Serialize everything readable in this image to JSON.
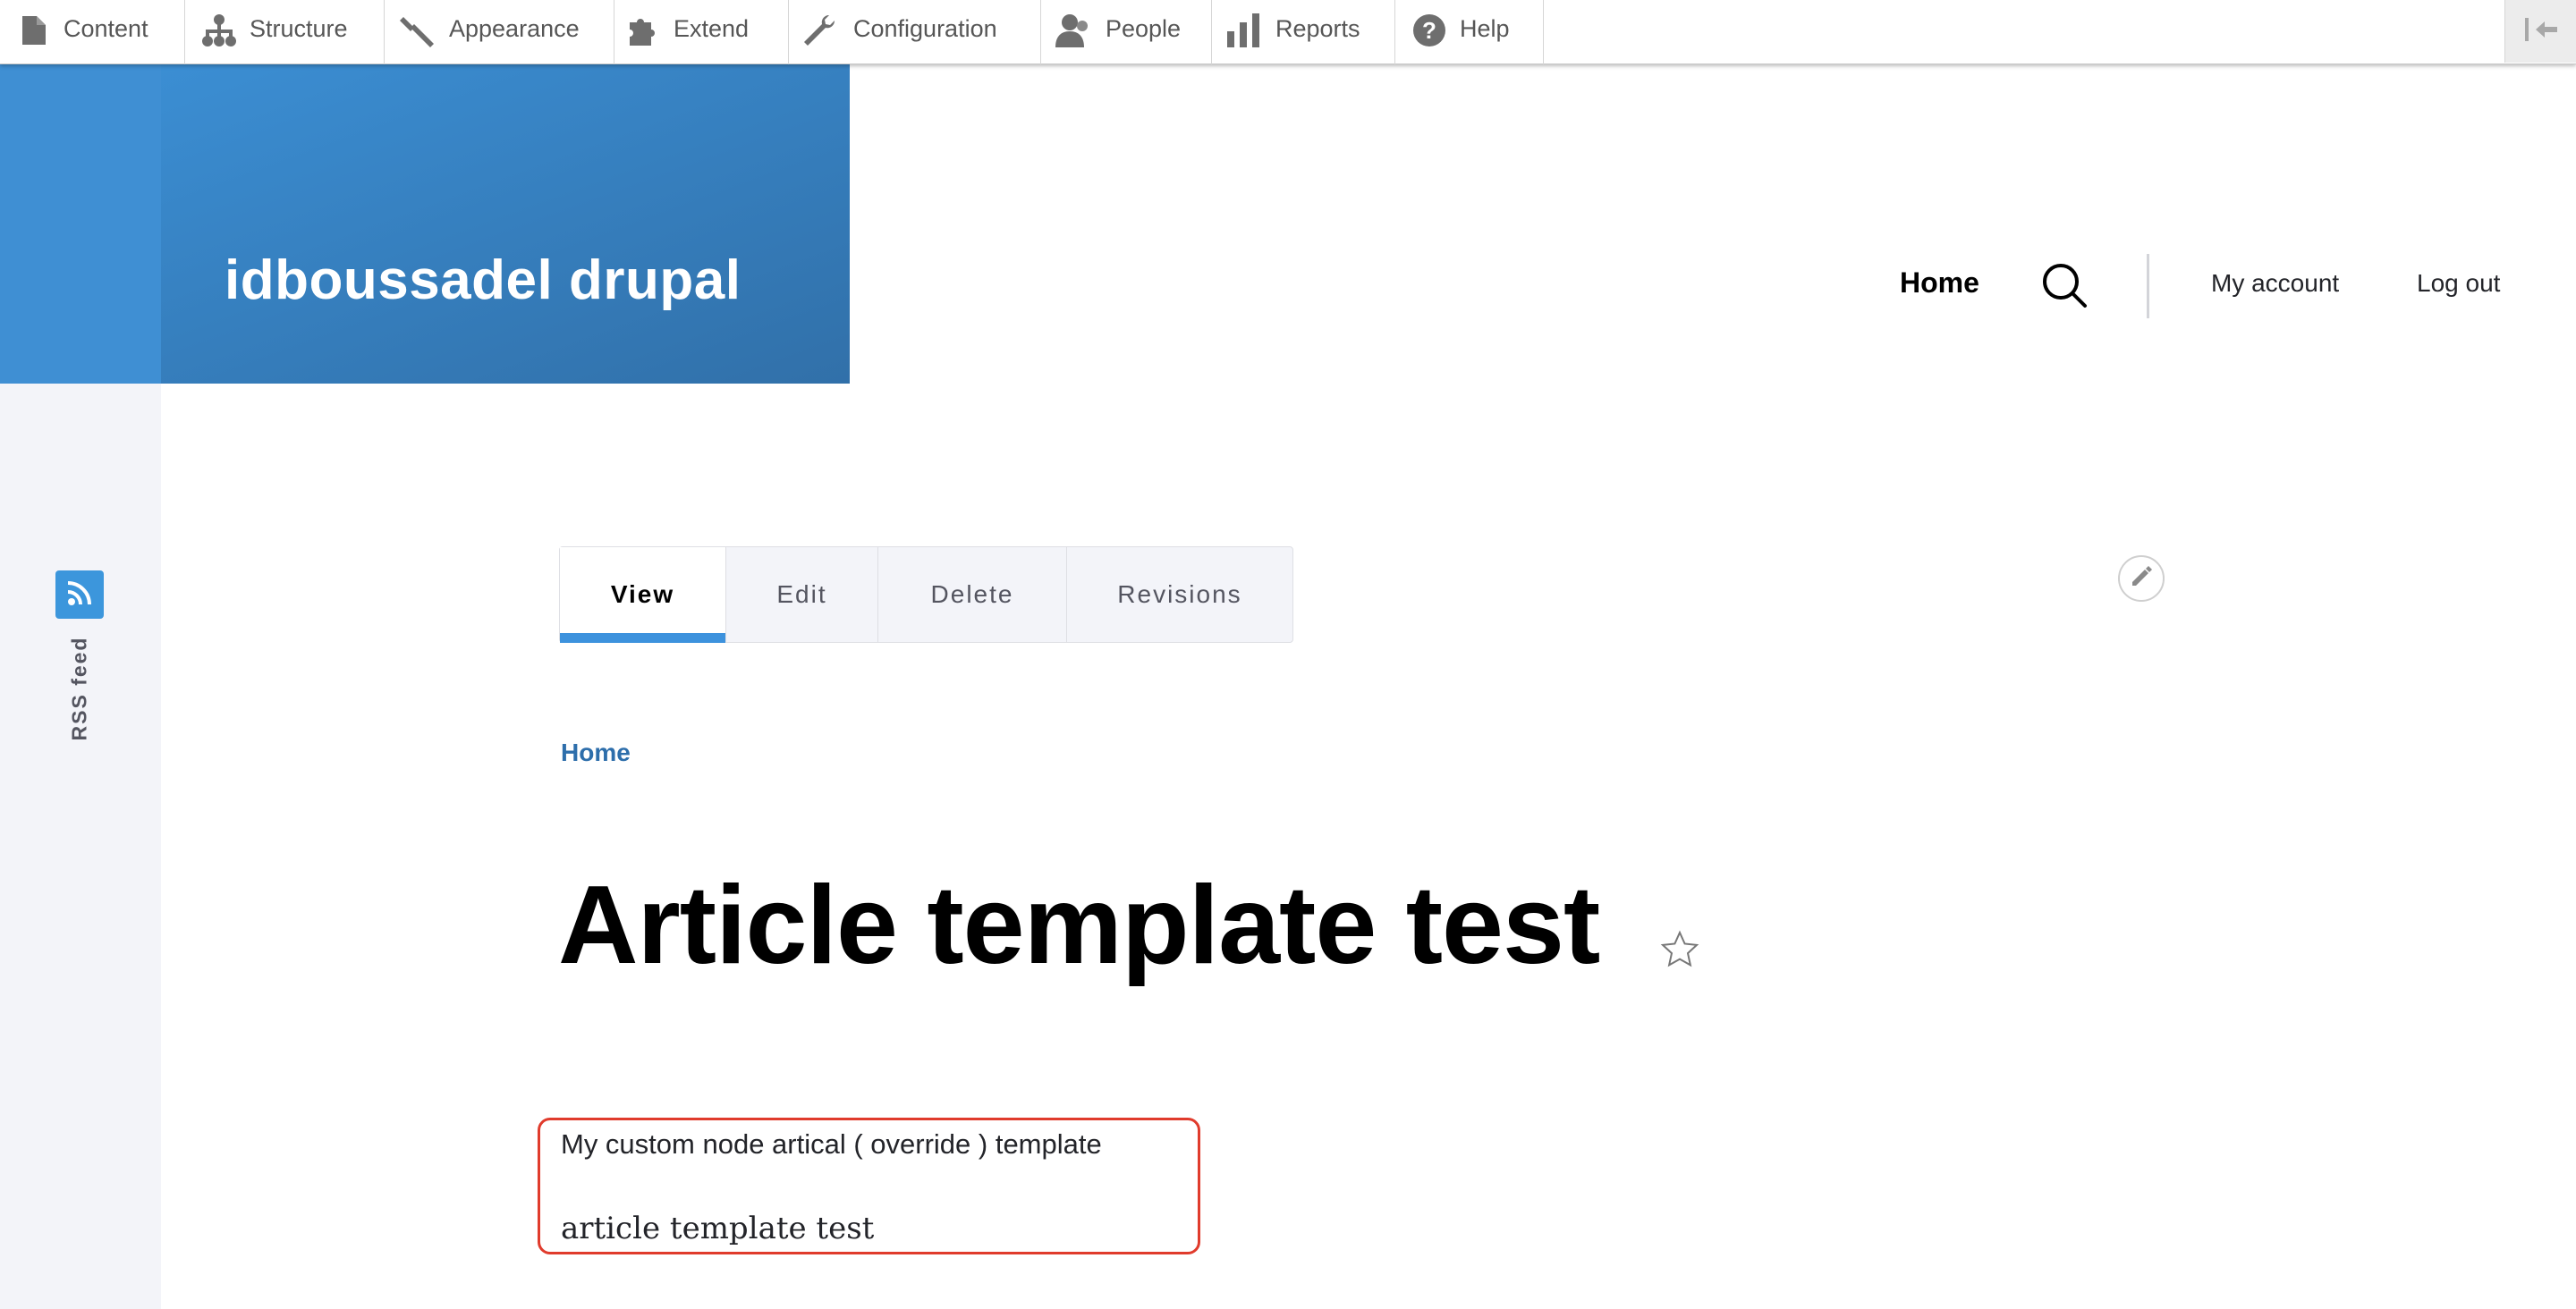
{
  "toolbar": {
    "items": [
      {
        "label": "Content",
        "icon": "file-icon"
      },
      {
        "label": "Structure",
        "icon": "sitemap-icon"
      },
      {
        "label": "Appearance",
        "icon": "paint-brush-icon"
      },
      {
        "label": "Extend",
        "icon": "puzzle-icon"
      },
      {
        "label": "Configuration",
        "icon": "wrench-icon"
      },
      {
        "label": "People",
        "icon": "people-icon"
      },
      {
        "label": "Reports",
        "icon": "bar-chart-icon"
      },
      {
        "label": "Help",
        "icon": "help-circle-icon"
      }
    ],
    "collapse_icon": "collapse-icon"
  },
  "sidebar": {
    "rss_label": "RSS feed",
    "rss_icon": "rss-icon"
  },
  "site": {
    "name": "idboussadel drupal"
  },
  "nav": {
    "home": "Home",
    "my_account": "My account",
    "log_out": "Log out"
  },
  "tabs": [
    "View",
    "Edit",
    "Delete",
    "Revisions"
  ],
  "active_tab": "View",
  "breadcrumb": {
    "home": "Home"
  },
  "page": {
    "title": "Article template test",
    "custom_text": "My custom node artical ( override ) template",
    "body_text": "article template test"
  },
  "colors": {
    "accent_blue": "#3d92dd",
    "link_blue": "#2d6eab",
    "highlight_red": "#e03b2c",
    "branding_gradient_start": "#3b8ed3",
    "branding_gradient_end": "#3170a9"
  }
}
